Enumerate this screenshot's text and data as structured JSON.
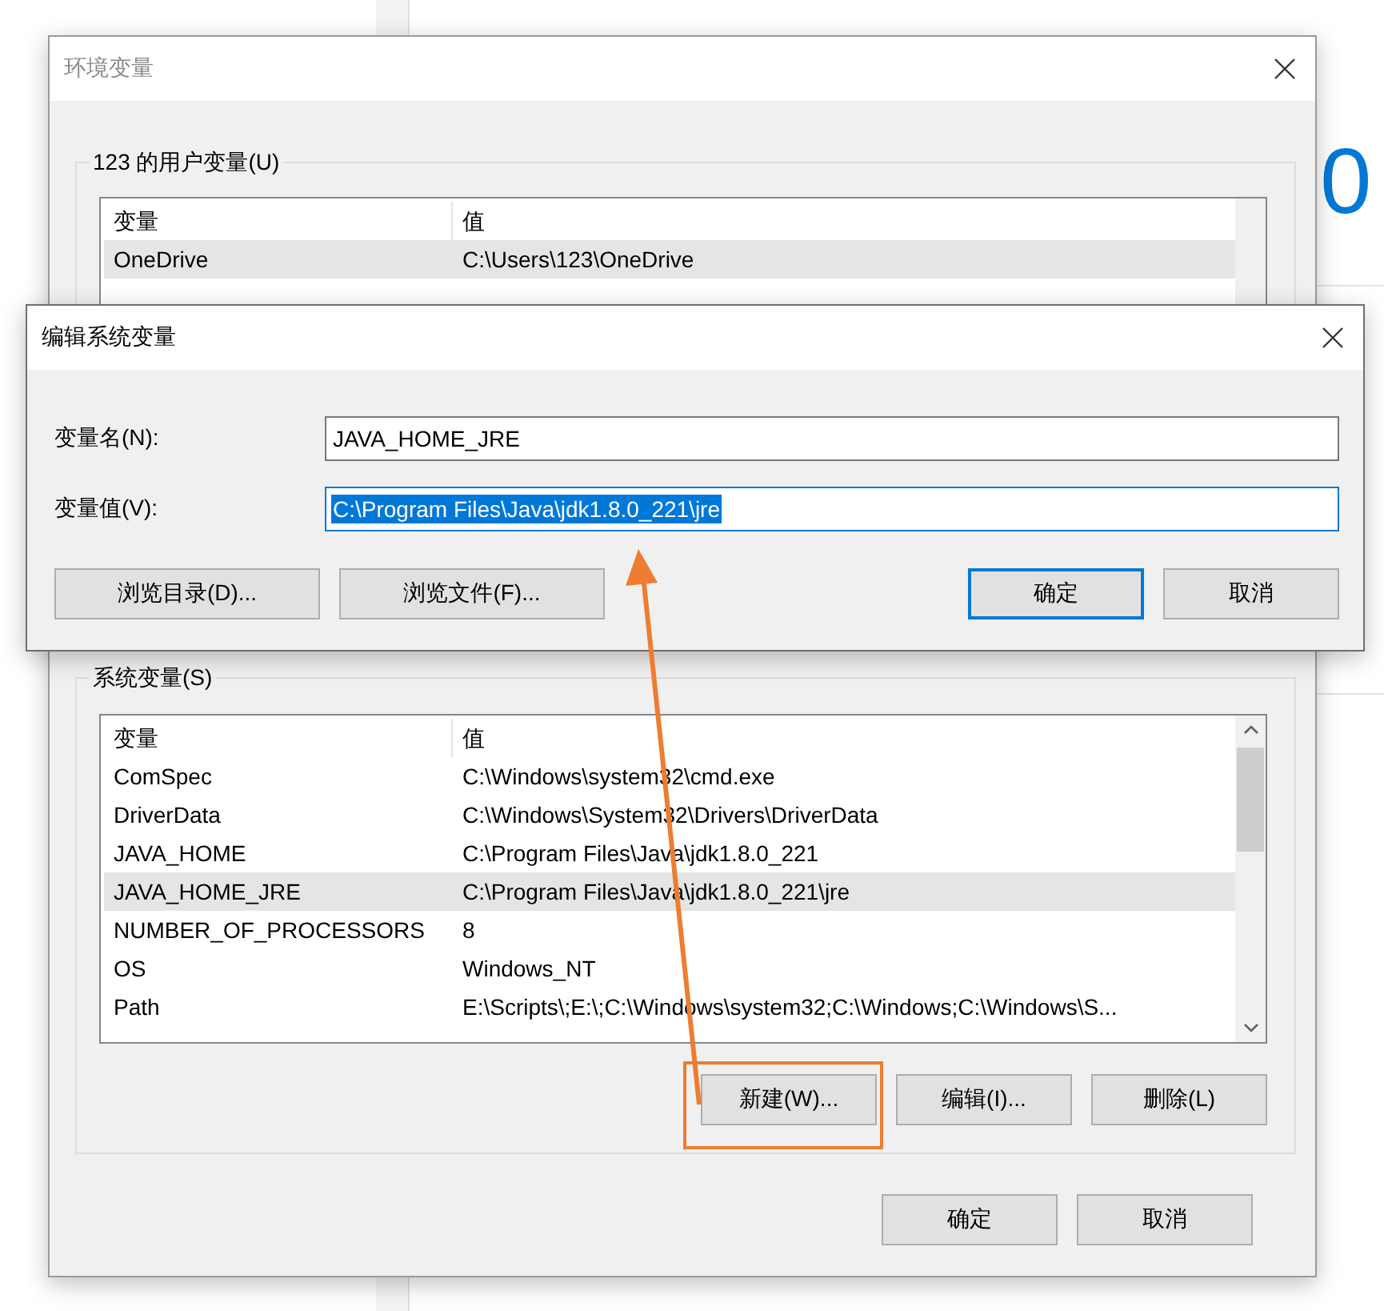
{
  "background": {
    "text": "0"
  },
  "env_dialog": {
    "title": "环境变量",
    "user_group": {
      "label": "123 的用户变量(U)",
      "columns": [
        "变量",
        "值"
      ],
      "rows": [
        {
          "name": "OneDrive",
          "value": "C:\\Users\\123\\OneDrive",
          "selected": true
        }
      ]
    },
    "system_group": {
      "label": "系统变量(S)",
      "columns": [
        "变量",
        "值"
      ],
      "rows": [
        {
          "name": "ComSpec",
          "value": "C:\\Windows\\system32\\cmd.exe",
          "selected": false
        },
        {
          "name": "DriverData",
          "value": "C:\\Windows\\System32\\Drivers\\DriverData",
          "selected": false
        },
        {
          "name": "JAVA_HOME",
          "value": "C:\\Program Files\\Java\\jdk1.8.0_221",
          "selected": false
        },
        {
          "name": "JAVA_HOME_JRE",
          "value": "C:\\Program Files\\Java\\jdk1.8.0_221\\jre",
          "selected": true
        },
        {
          "name": "NUMBER_OF_PROCESSORS",
          "value": "8",
          "selected": false
        },
        {
          "name": "OS",
          "value": "Windows_NT",
          "selected": false
        },
        {
          "name": "Path",
          "value": "E:\\Scripts\\;E:\\;C:\\Windows\\system32;C:\\Windows;C:\\Windows\\S...",
          "selected": false
        }
      ],
      "buttons": [
        {
          "label": "新建(W)...",
          "highlighted": true
        },
        {
          "label": "编辑(I)...",
          "highlighted": false
        },
        {
          "label": "删除(L)",
          "highlighted": false
        }
      ]
    },
    "buttons": [
      "确定",
      "取消"
    ]
  },
  "edit_dialog": {
    "title": "编辑系统变量",
    "fields": [
      {
        "label": "变量名(N):",
        "value": "JAVA_HOME_JRE",
        "selected": false
      },
      {
        "label": "变量值(V):",
        "value": "C:\\Program Files\\Java\\jdk1.8.0_221\\jre",
        "selected": true
      }
    ],
    "left_buttons": [
      "浏览目录(D)...",
      "浏览文件(F)..."
    ],
    "right_buttons": [
      {
        "label": "确定",
        "default": true
      },
      {
        "label": "取消",
        "default": false
      }
    ]
  }
}
